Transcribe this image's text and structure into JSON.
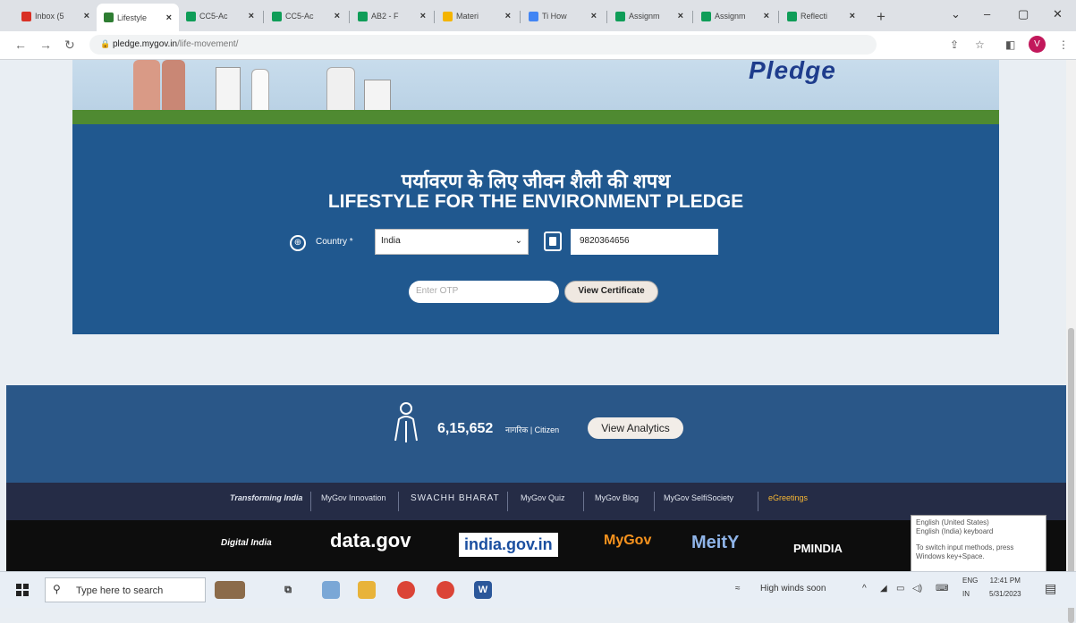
{
  "browser": {
    "tabs": [
      {
        "title": "Inbox (5",
        "icon": "gmail-icon",
        "color": "#d93025"
      },
      {
        "title": "Lifestyle",
        "icon": "lifestyle-icon",
        "color": "#2e7d32"
      },
      {
        "title": "CC5-Ac",
        "icon": "classroom-icon",
        "color": "#0f9d58"
      },
      {
        "title": "CC5-Ac",
        "icon": "classroom-icon",
        "color": "#0f9d58"
      },
      {
        "title": "AB2 - F",
        "icon": "classroom-icon",
        "color": "#0f9d58"
      },
      {
        "title": "Materi",
        "icon": "classroom-icon",
        "color": "#f4b400"
      },
      {
        "title": "Ti How",
        "icon": "drive-icon",
        "color": "#4285f4"
      },
      {
        "title": "Assignm",
        "icon": "classroom-icon",
        "color": "#0f9d58"
      },
      {
        "title": "Assignm",
        "icon": "classroom-icon",
        "color": "#0f9d58"
      },
      {
        "title": "Reflecti",
        "icon": "classroom-icon",
        "color": "#0f9d58"
      }
    ],
    "url_domain": "pledge.mygov.in",
    "url_path": "/life-movement/",
    "profile_initial": "V"
  },
  "banner": {
    "pledge_word": "Pledge"
  },
  "pledge": {
    "title_hindi": "पर्यावरण के लिए जीवन शैली की शपथ",
    "title_english": "LIFESTYLE FOR THE ENVIRONMENT PLEDGE",
    "country_label": "Country *",
    "country_value": "India",
    "mobile_value": "9820364656",
    "otp_placeholder": "Enter OTP",
    "view_certificate": "View Certificate"
  },
  "stats": {
    "count": "6,15,652",
    "citizen_label": "नागरिक | Citizen",
    "view_analytics": "View Analytics"
  },
  "partners": [
    "Transforming India",
    "MyGov Innovation",
    "SWACHH BHARAT",
    "MyGov Quiz",
    "MyGov Blog",
    "MyGov SelfiSociety",
    "eGreetings"
  ],
  "gov_logos": [
    "Digital India",
    "data.gov",
    "india.gov.in",
    "MyGov",
    "MeitY",
    "PMINDIA"
  ],
  "ime_tooltip": {
    "line1": "English (United States)",
    "line2": "English (India) keyboard",
    "line3": "To switch input methods, press Windows key+Space."
  },
  "taskbar": {
    "search_placeholder": "Type here to search",
    "weather": "High winds soon",
    "lang_top": "ENG",
    "lang_bottom": "IN",
    "time": "12:41 PM",
    "date": "5/31/2023"
  }
}
